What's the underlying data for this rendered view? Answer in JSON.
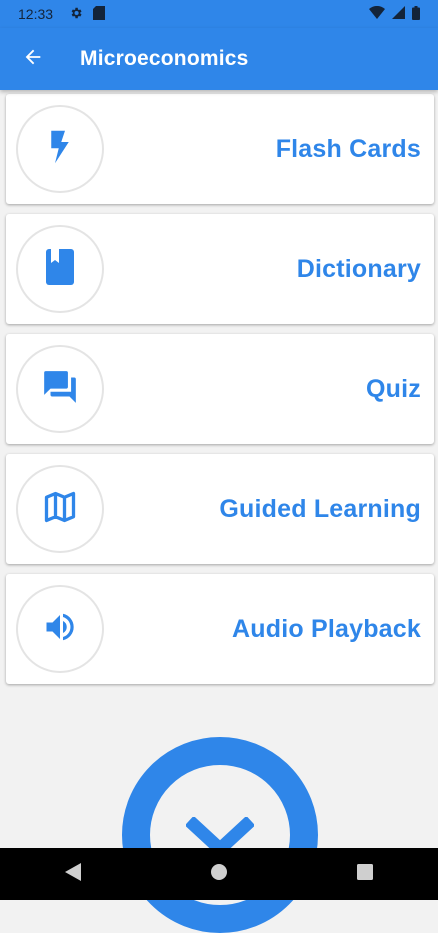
{
  "status_bar": {
    "time": "12:33",
    "icons": [
      "settings-icon",
      "sd-card-icon",
      "wifi-icon",
      "signal-icon",
      "battery-icon"
    ]
  },
  "app_bar": {
    "title": "Microeconomics",
    "back_icon": "arrow-back-icon",
    "color": "#2f86e9"
  },
  "menu": {
    "items": [
      {
        "label": "Flash Cards",
        "icon": "flash-icon"
      },
      {
        "label": "Dictionary",
        "icon": "book-icon"
      },
      {
        "label": "Quiz",
        "icon": "forum-icon"
      },
      {
        "label": "Guided Learning",
        "icon": "map-icon"
      },
      {
        "label": "Audio Playback",
        "icon": "volume-icon"
      }
    ]
  },
  "fab": {
    "icon": "chevron-down-icon"
  },
  "nav_bar": {
    "icons": [
      "back-triangle-icon",
      "home-circle-icon",
      "recents-square-icon"
    ]
  },
  "colors": {
    "accent": "#2f86e9",
    "background": "#f2f2f2",
    "card": "#ffffff"
  }
}
